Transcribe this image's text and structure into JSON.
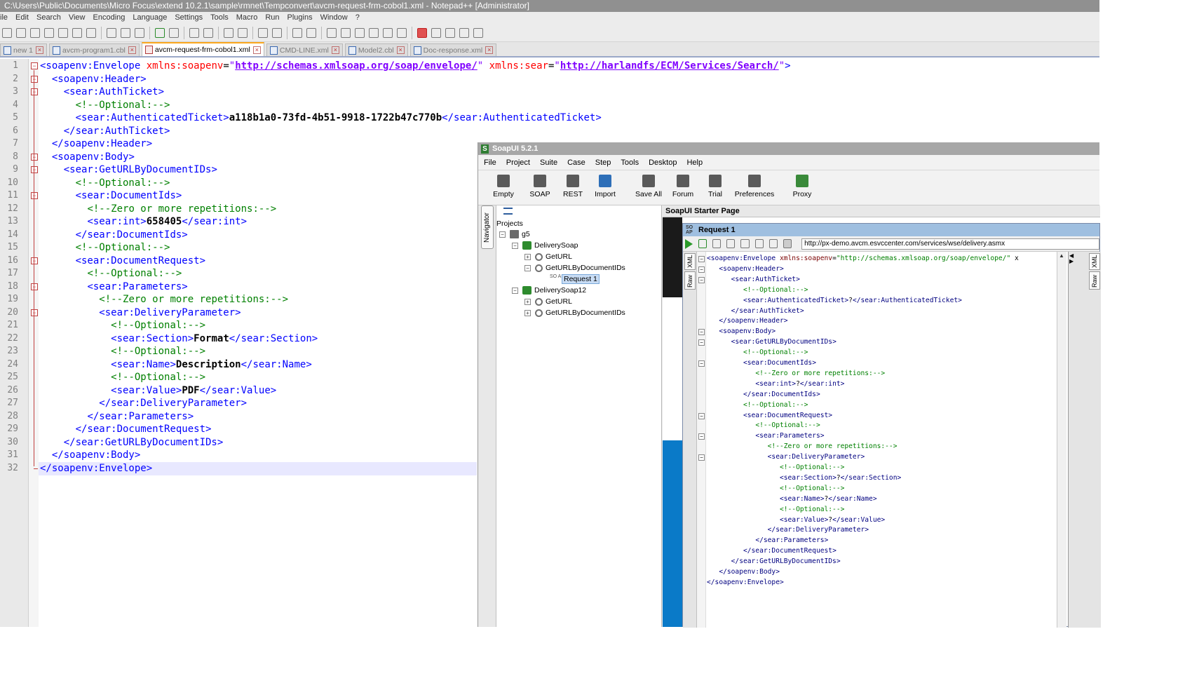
{
  "window": {
    "title": "C:\\Users\\Public\\Documents\\Micro Focus\\extend 10.2.1\\sample\\rmnet\\Tempconvert\\avcm-request-frm-cobol1.xml - Notepad++ [Administrator]"
  },
  "menu": [
    "ile",
    "Edit",
    "Search",
    "View",
    "Encoding",
    "Language",
    "Settings",
    "Tools",
    "Macro",
    "Run",
    "Plugins",
    "Window",
    "?"
  ],
  "tabs": [
    {
      "label": "new 1",
      "active": false,
      "icon": "file-icon"
    },
    {
      "label": "avcm-program1.cbl",
      "active": false,
      "icon": "file-icon"
    },
    {
      "label": "avcm-request-frm-cobol1.xml",
      "active": true,
      "icon": "file-icon-red"
    },
    {
      "label": "CMD-LINE.xml",
      "active": false,
      "icon": "file-icon"
    },
    {
      "label": "Model2.cbl",
      "active": false,
      "icon": "file-icon"
    },
    {
      "label": "Doc-response.xml",
      "active": false,
      "icon": "file-icon"
    }
  ],
  "editor": {
    "current_line": 32,
    "lines": [
      "<soapenv:Envelope xmlns:soapenv=\"http://schemas.xmlsoap.org/soap/envelope/\" xmlns:sear=\"http://harlandfs/ECM/Services/Search/\">",
      "  <soapenv:Header>",
      "    <sear:AuthTicket>",
      "      <!--Optional:-->",
      "      <sear:AuthenticatedTicket>a118b1a0-73fd-4b51-9918-1722b47c770b</sear:AuthenticatedTicket>",
      "    </sear:AuthTicket>",
      "  </soapenv:Header>",
      "  <soapenv:Body>",
      "    <sear:GetURLByDocumentIDs>",
      "      <!--Optional:-->",
      "      <sear:DocumentIds>",
      "        <!--Zero or more repetitions:-->",
      "        <sear:int>658405</sear:int>",
      "      </sear:DocumentIds>",
      "      <!--Optional:-->",
      "      <sear:DocumentRequest>",
      "        <!--Optional:-->",
      "        <sear:Parameters>",
      "          <!--Zero or more repetitions:-->",
      "          <sear:DeliveryParameter>",
      "            <!--Optional:-->",
      "            <sear:Section>Format</sear:Section>",
      "            <!--Optional:-->",
      "            <sear:Name>Description</sear:Name>",
      "            <!--Optional:-->",
      "            <sear:Value>PDF</sear:Value>",
      "          </sear:DeliveryParameter>",
      "        </sear:Parameters>",
      "      </sear:DocumentRequest>",
      "    </sear:GetURLByDocumentIDs>",
      "  </soapenv:Body>",
      "</soapenv:Envelope>"
    ]
  },
  "soapui": {
    "title": "SoapUI 5.2.1",
    "menu": [
      "File",
      "Project",
      "Suite",
      "Case",
      "Step",
      "Tools",
      "Desktop",
      "Help"
    ],
    "toolbar": [
      {
        "label": "Empty",
        "icon": "empty-project-icon"
      },
      {
        "label": "SOAP",
        "icon": "soap-project-icon"
      },
      {
        "label": "REST",
        "icon": "rest-project-icon"
      },
      {
        "label": "Import",
        "icon": "import-icon"
      },
      {
        "label": "Save All",
        "icon": "save-all-icon"
      },
      {
        "label": "Forum",
        "icon": "forum-icon"
      },
      {
        "label": "Trial",
        "icon": "trial-icon"
      },
      {
        "label": "Preferences",
        "icon": "gear-icon"
      },
      {
        "label": "Proxy",
        "icon": "proxy-icon"
      }
    ],
    "navigator_label": "Navigator",
    "tree": {
      "root": "Projects",
      "project": "g5",
      "interfaces": [
        {
          "name": "DeliverySoap",
          "operations": [
            {
              "name": "GetURL",
              "requests": []
            },
            {
              "name": "GetURLByDocumentIDs",
              "requests": [
                "Request 1"
              ]
            }
          ]
        },
        {
          "name": "DeliverySoap12",
          "operations": [
            {
              "name": "GetURL",
              "requests": []
            },
            {
              "name": "GetURLByDocumentIDs",
              "requests": []
            }
          ]
        }
      ]
    },
    "starter_page_title": "SoapUI Starter Page",
    "request": {
      "title": "Request 1",
      "url": "http://px-demo.avcm.esvccenter.com/services/wse/delivery.asmx",
      "side_tabs": [
        "XML",
        "Raw"
      ],
      "xml_lines": [
        "<soapenv:Envelope xmlns:soapenv=\"http://schemas.xmlsoap.org/soap/envelope/\" x",
        "   <soapenv:Header>",
        "      <sear:AuthTicket>",
        "         <!--Optional:-->",
        "         <sear:AuthenticatedTicket>?</sear:AuthenticatedTicket>",
        "      </sear:AuthTicket>",
        "   </soapenv:Header>",
        "   <soapenv:Body>",
        "      <sear:GetURLByDocumentIDs>",
        "         <!--Optional:-->",
        "         <sear:DocumentIds>",
        "            <!--Zero or more repetitions:-->",
        "            <sear:int>?</sear:int>",
        "         </sear:DocumentIds>",
        "         <!--Optional:-->",
        "         <sear:DocumentRequest>",
        "            <!--Optional:-->",
        "            <sear:Parameters>",
        "               <!--Zero or more repetitions:-->",
        "               <sear:DeliveryParameter>",
        "                  <!--Optional:-->",
        "                  <sear:Section>?</sear:Section>",
        "                  <!--Optional:-->",
        "                  <sear:Name>?</sear:Name>",
        "                  <!--Optional:-->",
        "                  <sear:Value>?</sear:Value>",
        "               </sear:DeliveryParameter>",
        "            </sear:Parameters>",
        "         </sear:DocumentRequest>",
        "      </sear:GetURLByDocumentIDs>",
        "   </soapenv:Body>",
        "</soapenv:Envelope>"
      ]
    }
  },
  "colors": {
    "tag": "#0000ff",
    "attr": "#ff0000",
    "value": "#8000ff",
    "comment": "#008000",
    "active_tab_accent": "#fba81e",
    "soapui_request_title": "#9fbfe0",
    "blue_band": "#0a7ac8"
  }
}
